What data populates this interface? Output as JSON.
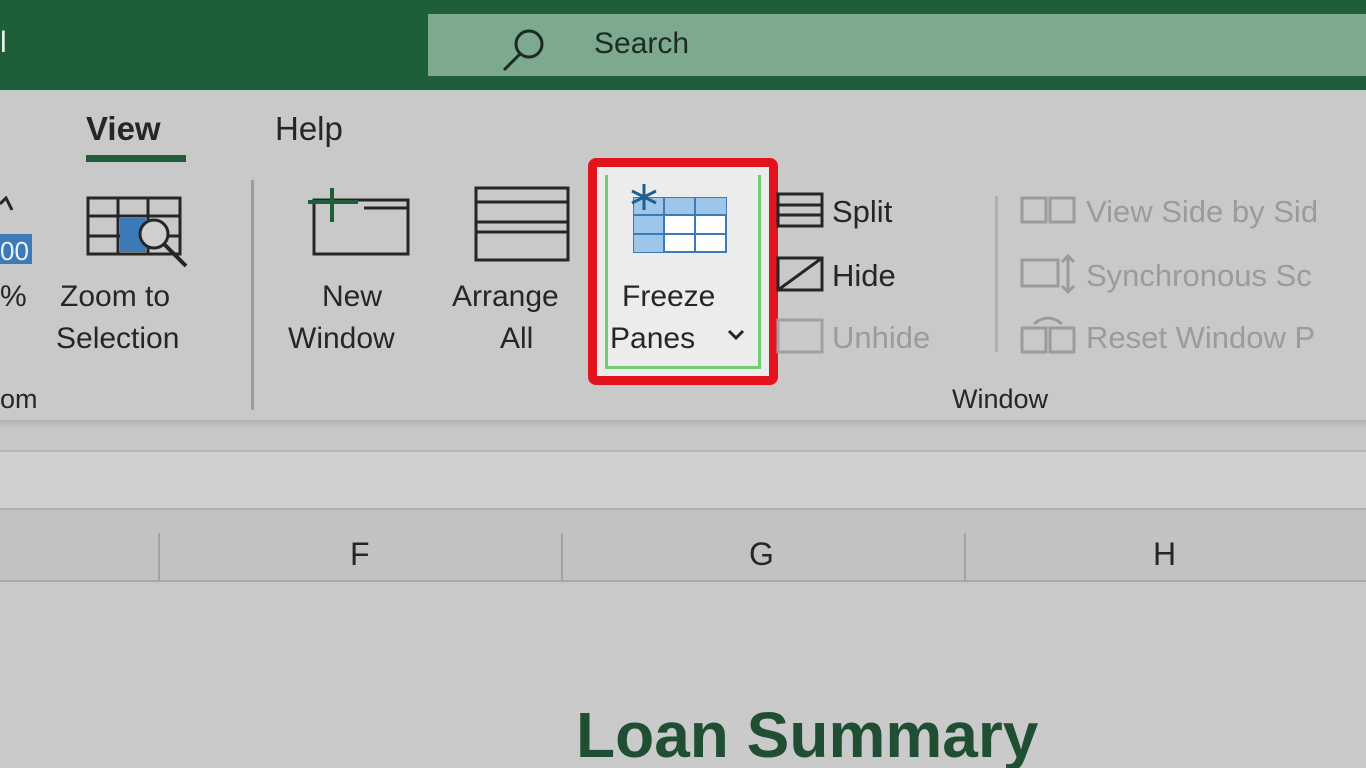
{
  "titlebar": {
    "fragment": "l",
    "search_label": "Search",
    "search_icon": "search-icon",
    "color": "#1e5f3a"
  },
  "tabs": [
    {
      "label": "View",
      "active": true
    },
    {
      "label": "Help",
      "active": false
    }
  ],
  "zoom_group": {
    "fragment_100": "00",
    "fragment_pct": "%",
    "zoom_to_selection": [
      "Zoom to",
      "Selection"
    ],
    "group_label": "om"
  },
  "window_group": {
    "new_window": [
      "New",
      "Window"
    ],
    "arrange_all": [
      "Arrange",
      "All"
    ],
    "freeze_panes": [
      "Freeze",
      "Panes"
    ],
    "split": "Split",
    "hide": "Hide",
    "unhide": "Unhide",
    "view_side_by_side": "View Side by Sid",
    "synchronous_scrolling": "Synchronous Sc",
    "reset_window_position": "Reset Window P",
    "group_label": "Window"
  },
  "columns": [
    "F",
    "G",
    "H"
  ],
  "sheet": {
    "title": "Loan Summary"
  },
  "colors": {
    "accent_green": "#1e5f3a",
    "highlight_red": "#e2131c",
    "icon_blue": "#3d7ab8"
  }
}
